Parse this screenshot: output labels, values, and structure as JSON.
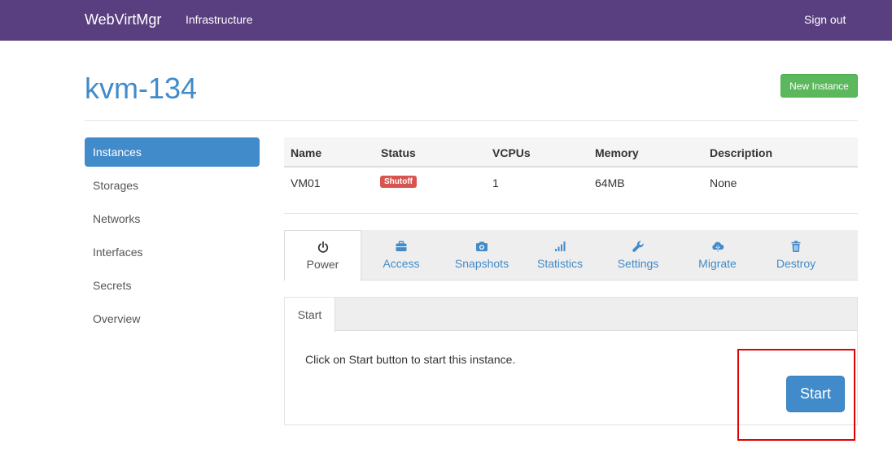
{
  "navbar": {
    "brand": "WebVirtMgr",
    "infrastructure": "Infrastructure",
    "signout": "Sign out",
    "color": "#5a3f80"
  },
  "header": {
    "title": "kvm-134",
    "new_instance": "New Instance"
  },
  "sidebar": {
    "items": [
      {
        "label": "Instances",
        "active": true
      },
      {
        "label": "Storages"
      },
      {
        "label": "Networks"
      },
      {
        "label": "Interfaces"
      },
      {
        "label": "Secrets"
      },
      {
        "label": "Overview"
      }
    ]
  },
  "table": {
    "headers": [
      "Name",
      "Status",
      "VCPUs",
      "Memory",
      "Description"
    ],
    "rows": [
      {
        "name": "VM01",
        "status": "Shutoff",
        "vcpus": "1",
        "memory": "64MB",
        "description": "None"
      }
    ]
  },
  "tabs": [
    {
      "label": "Power",
      "icon": "power-icon",
      "active": true
    },
    {
      "label": "Access",
      "icon": "briefcase-icon"
    },
    {
      "label": "Snapshots",
      "icon": "camera-icon"
    },
    {
      "label": "Statistics",
      "icon": "signal-bars-icon"
    },
    {
      "label": "Settings",
      "icon": "wrench-icon"
    },
    {
      "label": "Migrate",
      "icon": "cloud-upload-icon"
    },
    {
      "label": "Destroy",
      "icon": "trash-icon"
    }
  ],
  "power_panel": {
    "subtab": "Start",
    "message": "Click on Start button to start this instance.",
    "start_button": "Start"
  },
  "colors": {
    "primary": "#428bca",
    "success": "#5cb85c",
    "danger": "#d9534f",
    "highlight": "#e00000"
  }
}
